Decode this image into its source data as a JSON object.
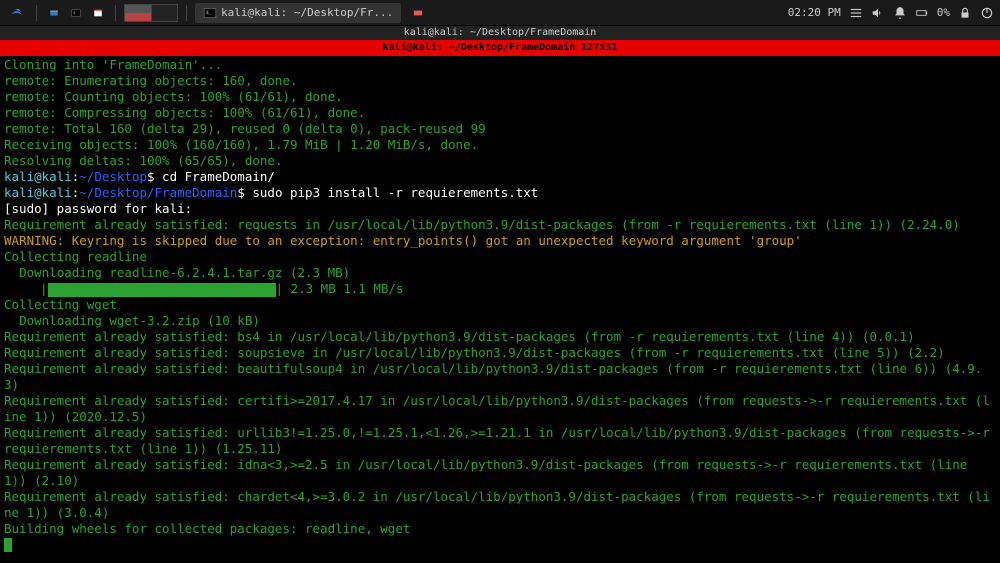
{
  "panel": {
    "active_window_label": "kali@kali: ~/Desktop/Fr...",
    "time": "02:20 PM",
    "battery_percent": "0%"
  },
  "terminal": {
    "title": "kali@kali: ~/Desktop/FrameDomain",
    "tab": "kali@kali: ~/Desktop/FrameDomain 127x31",
    "lines": [
      {
        "parts": [
          {
            "t": "Cloning into 'FrameDomain'..."
          }
        ]
      },
      {
        "parts": [
          {
            "t": "remote: Enumerating objects: 160, done."
          }
        ]
      },
      {
        "parts": [
          {
            "t": "remote: Counting objects: 100% (61/61), done."
          }
        ]
      },
      {
        "parts": [
          {
            "t": "remote: Compressing objects: 100% (61/61), done."
          }
        ]
      },
      {
        "parts": [
          {
            "t": "remote: Total 160 (delta 29), reused 0 (delta 0), pack-reused 99"
          }
        ]
      },
      {
        "parts": [
          {
            "t": "Receiving objects: 100% (160/160), 1.79 MiB | 1.20 MiB/s, done."
          }
        ]
      },
      {
        "parts": [
          {
            "t": "Resolving deltas: 100% (65/65), done."
          }
        ]
      },
      {
        "parts": [
          {
            "t": "kali@kali",
            "c": "c-cyan"
          },
          {
            "t": ":",
            "c": "c-white"
          },
          {
            "t": "~/Desktop",
            "c": "c-blue"
          },
          {
            "t": "$ cd FrameDomain/",
            "c": "c-white"
          }
        ]
      },
      {
        "parts": [
          {
            "t": "kali@kali",
            "c": "c-cyan"
          },
          {
            "t": ":",
            "c": "c-white"
          },
          {
            "t": "~/Desktop/FrameDomain",
            "c": "c-blue"
          },
          {
            "t": "$ sudo pip3 install -r requierements.txt",
            "c": "c-white"
          }
        ]
      },
      {
        "parts": [
          {
            "t": "[sudo] password for kali: ",
            "c": "c-white"
          }
        ]
      },
      {
        "parts": [
          {
            "t": "Requirement already satisfied: requests in /usr/local/lib/python3.9/dist-packages (from -r requierements.txt (line 1)) (2.24.0)"
          }
        ]
      },
      {
        "parts": [
          {
            "t": "WARNING: Keyring is skipped due to an exception: entry_points() got an unexpected keyword argument 'group'",
            "c": "c-yellow"
          }
        ]
      },
      {
        "parts": [
          {
            "t": "Collecting readline"
          }
        ]
      },
      {
        "parts": [
          {
            "t": "  Downloading readline-6.2.4.1.tar.gz (2.3 MB)"
          }
        ]
      },
      {
        "raw_progress": true,
        "left": "     |",
        "bar_text": "",
        "right": "| 2.3 MB 1.1 MB/s"
      },
      {
        "parts": [
          {
            "t": "Collecting wget"
          }
        ]
      },
      {
        "parts": [
          {
            "t": "  Downloading wget-3.2.zip (10 kB)"
          }
        ]
      },
      {
        "parts": [
          {
            "t": "Requirement already satisfied: bs4 in /usr/local/lib/python3.9/dist-packages (from -r requierements.txt (line 4)) (0.0.1)"
          }
        ]
      },
      {
        "parts": [
          {
            "t": "Requirement already satisfied: soupsieve in /usr/local/lib/python3.9/dist-packages (from -r requierements.txt (line 5)) (2.2)"
          }
        ]
      },
      {
        "parts": [
          {
            "t": "Requirement already satisfied: beautifulsoup4 in /usr/local/lib/python3.9/dist-packages (from -r requierements.txt (line 6)) (4.9.3)"
          }
        ]
      },
      {
        "parts": [
          {
            "t": "Requirement already satisfied: certifi>=2017.4.17 in /usr/local/lib/python3.9/dist-packages (from requests->-r requierements.txt (line 1)) (2020.12.5)"
          }
        ]
      },
      {
        "parts": [
          {
            "t": "Requirement already satisfied: urllib3!=1.25.0,!=1.25.1,<1.26,>=1.21.1 in /usr/local/lib/python3.9/dist-packages (from requests->-r requierements.txt (line 1)) (1.25.11)"
          }
        ]
      },
      {
        "parts": [
          {
            "t": "Requirement already satisfied: idna<3,>=2.5 in /usr/local/lib/python3.9/dist-packages (from requests->-r requierements.txt (line 1)) (2.10)"
          }
        ]
      },
      {
        "parts": [
          {
            "t": "Requirement already satisfied: chardet<4,>=3.0.2 in /usr/local/lib/python3.9/dist-packages (from requests->-r requierements.txt (line 1)) (3.0.4)"
          }
        ]
      },
      {
        "parts": [
          {
            "t": "Building wheels for collected packages: readline, wget"
          }
        ]
      },
      {
        "cursor": true
      }
    ]
  }
}
